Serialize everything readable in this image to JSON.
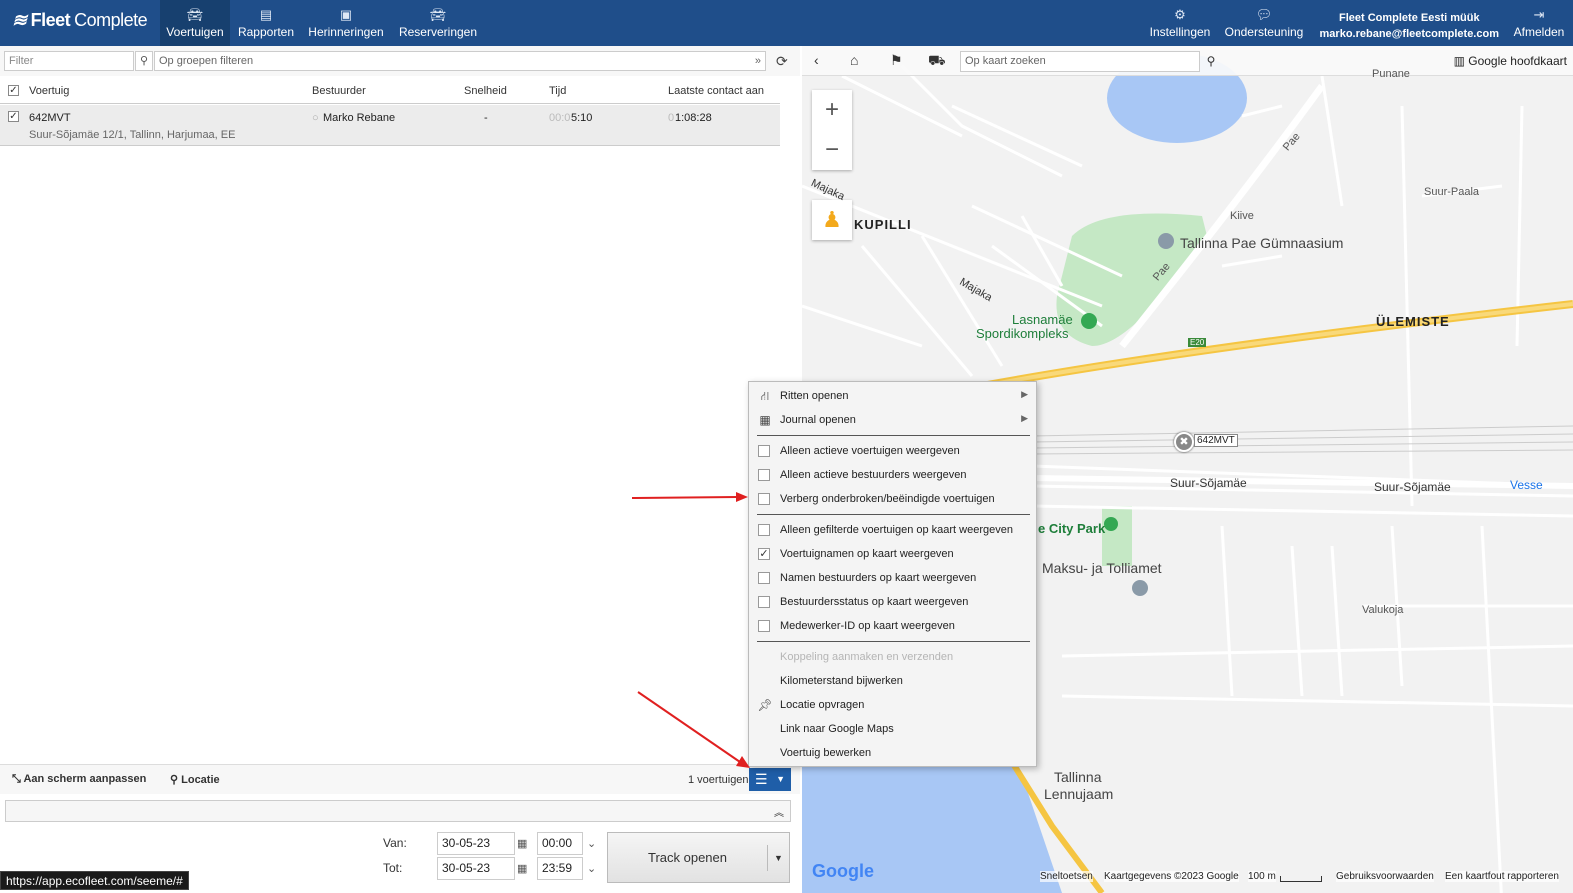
{
  "brand": {
    "name_bold": "Fleet",
    "name_light": "Complete"
  },
  "nav": [
    {
      "label": "Voertuigen",
      "icon": "car-icon"
    },
    {
      "label": "Rapporten",
      "icon": "document-icon"
    },
    {
      "label": "Herinneringen",
      "icon": "calendar-icon"
    },
    {
      "label": "Reserveringen",
      "icon": "car-reservation-icon"
    }
  ],
  "topright": {
    "settings": "Instellingen",
    "support": "Ondersteuning",
    "company": "Fleet Complete Eesti müük",
    "email": "marko.rebane@fleetcomplete.com",
    "logout": "Afmelden"
  },
  "filters": {
    "filter_placeholder": "Filter",
    "group_placeholder": "Op groepen filteren"
  },
  "table": {
    "columns": [
      "Voertuig",
      "Bestuurder",
      "Snelheid",
      "Tijd",
      "Laatste contact aan"
    ],
    "rows": [
      {
        "vehicle": "642MVT",
        "address": "Suur-Sõjamäe 12/1, Tallinn, Harjumaa, EE",
        "driver": "Marko Rebane",
        "speed": "-",
        "time_dim": "00:0",
        "time": "5:10",
        "contact_dim": "0",
        "contact": "1:08:28"
      }
    ]
  },
  "bottom": {
    "fit": "Aan scherm aanpassen",
    "location": "Locatie",
    "count": "1 voertuigen"
  },
  "track": {
    "from_label": "Van:",
    "to_label": "Tot:",
    "from_date": "30-05-23",
    "from_time": "00:00",
    "to_date": "30-05-23",
    "to_time": "23:59",
    "button": "Track openen"
  },
  "status_url": "https://app.ecofleet.com/seeme/#",
  "map": {
    "search_placeholder": "Op kaart zoeken",
    "map_type": "Google hoofdkaart",
    "labels": {
      "kupilli": "KUPILLI",
      "ulemiste": "ÜLEMISTE",
      "gymnasium": "Tallinna Pae Gümnaasium",
      "sport1": "Lasnamäe",
      "sport2": "Spordikompleks",
      "suur1": "Suur-Sõjamäe",
      "suur2": "Suur-Sõjamäe",
      "vesse": "Vesse",
      "citypark": "e City Park",
      "maksu": "Maksu- ja Tolliamet",
      "airport1": "Tallinna",
      "airport2": "Lennujaam",
      "pae": "Pae",
      "majaka": "Majaka",
      "punane": "Punane",
      "valukoja": "Valukoja",
      "suurpaala": "Suur-Paala",
      "kiive": "Kiive",
      "e20": "E20"
    },
    "vehicle_tag": "642MVT",
    "attribution": {
      "shortcuts": "Sneltoetsen",
      "data": "Kaartgegevens ©2023 Google",
      "scale": "100 m",
      "terms": "Gebruiksvoorwaarden",
      "report": "Een kaartfout rapporteren"
    }
  },
  "menu": {
    "items": [
      {
        "label": "Ritten openen",
        "kind": "icon",
        "icon": "road-icon",
        "submenu": true
      },
      {
        "label": "Journal openen",
        "kind": "icon",
        "icon": "calendar-icon",
        "submenu": true
      },
      {
        "label": "Alleen actieve voertuigen weergeven",
        "kind": "check",
        "checked": false
      },
      {
        "label": "Alleen actieve bestuurders weergeven",
        "kind": "check",
        "checked": false
      },
      {
        "label": "Verberg onderbroken/beëindigde voertuigen",
        "kind": "check",
        "checked": false
      },
      {
        "label": "Alleen gefilterde voertuigen op kaart weergeven",
        "kind": "check",
        "checked": false
      },
      {
        "label": "Voertuignamen op kaart weergeven",
        "kind": "check",
        "checked": true
      },
      {
        "label": "Namen bestuurders op kaart weergeven",
        "kind": "check",
        "checked": false
      },
      {
        "label": "Bestuurdersstatus op kaart weergeven",
        "kind": "check",
        "checked": false
      },
      {
        "label": "Medewerker-ID op kaart weergeven",
        "kind": "check",
        "checked": false
      },
      {
        "label": "Koppeling aanmaken en verzenden",
        "kind": "plain",
        "disabled": true
      },
      {
        "label": "Kilometerstand bijwerken",
        "kind": "plain"
      },
      {
        "label": "Locatie opvragen",
        "kind": "icon",
        "icon": "pin-icon"
      },
      {
        "label": "Link naar Google Maps",
        "kind": "plain"
      },
      {
        "label": "Voertuig bewerken",
        "kind": "plain"
      }
    ]
  },
  "colors": {
    "nav_bg": "#1f4e8a",
    "accent": "#1f5ea8",
    "arrow": "#e02020"
  }
}
